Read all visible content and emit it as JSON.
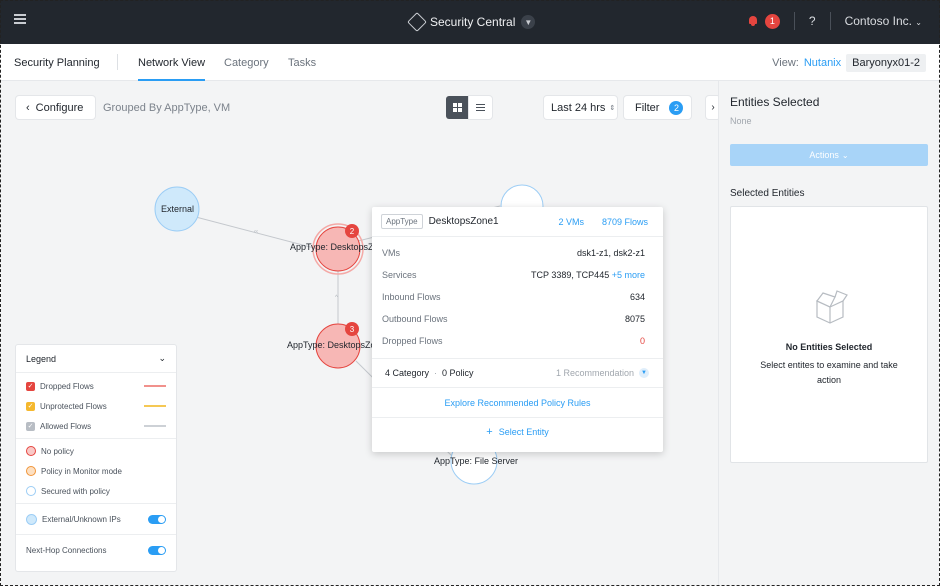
{
  "app": {
    "title": "Security Central",
    "notifications": "1",
    "help": "?",
    "account": "Contoso Inc."
  },
  "subnav": {
    "title": "Security Planning",
    "tabs": [
      "Network View",
      "Category",
      "Tasks"
    ],
    "view_label": "View:",
    "view_vendor": "Nutanix",
    "view_cluster": "Baryonyx01-2"
  },
  "toolbar": {
    "configure_label": "Configure",
    "grouped_by": "Grouped By AppType, VM",
    "time_range": "Last 24 hrs",
    "filter_label": "Filter",
    "filter_count": "2"
  },
  "graph": {
    "nodes": [
      {
        "label": "External",
        "badge": ""
      },
      {
        "label": "AppType: DesktopsZo",
        "badge": "2"
      },
      {
        "label": "AppType: DesktopsZo",
        "badge": "3"
      },
      {
        "label": "AppType: File Server",
        "badge": ""
      }
    ]
  },
  "legend": {
    "title": "Legend",
    "flows": [
      {
        "label": "Dropped Flows",
        "color": "#e5453f"
      },
      {
        "label": "Unprotected Flows",
        "color": "#f5b82e"
      },
      {
        "label": "Allowed Flows",
        "color": "#b8bdc4"
      }
    ],
    "policies": [
      {
        "label": "No policy",
        "fill": "#f9c9c7",
        "stroke": "#e5453f"
      },
      {
        "label": "Policy in Monitor mode",
        "fill": "#fde0c2",
        "stroke": "#f0953a"
      },
      {
        "label": "Secured with policy",
        "fill": "#ffffff",
        "stroke": "#9ccdf5"
      }
    ],
    "external_label": "External/Unknown IPs",
    "nexthop_label": "Next-Hop Connections"
  },
  "popover": {
    "tag": "AppType",
    "name": "DesktopsZone1",
    "vm_count": "2 VMs",
    "flow_count": "8709 Flows",
    "rows": [
      {
        "label": "VMs",
        "value": "dsk1-z1, dsk2-z1"
      },
      {
        "label": "Services",
        "value": "TCP 3389, TCP445",
        "extra": "+5 more"
      },
      {
        "label": "Inbound Flows",
        "value": "634"
      },
      {
        "label": "Outbound Flows",
        "value": "8075"
      },
      {
        "label": "Dropped Flows",
        "value": "0"
      }
    ],
    "category": "4 Category",
    "policy": "0 Policy",
    "recommendation": "1 Recommendation",
    "explore": "Explore Recommended Policy Rules",
    "select_entity": "Select Entity"
  },
  "panel": {
    "title": "Entities Selected",
    "none": "None",
    "actions_label": "Actions",
    "selected_header": "Selected Entities",
    "empty_title": "No Entities Selected",
    "empty_desc": "Select entites to examine and take action"
  }
}
